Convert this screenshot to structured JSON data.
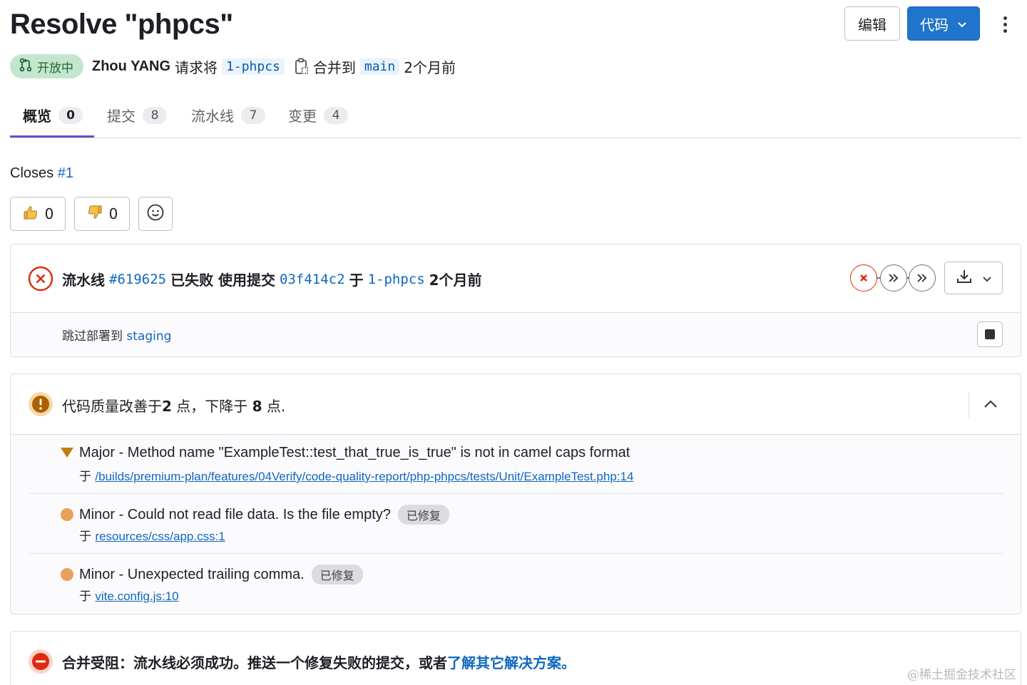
{
  "header": {
    "title": "Resolve \"phpcs\"",
    "edit_label": "编辑",
    "code_label": "代码"
  },
  "meta": {
    "status": "开放中",
    "author": "Zhou YANG",
    "request_text": "请求将",
    "source_branch": "1-phpcs",
    "merge_to_text": "合并到",
    "target_branch": "main",
    "time_ago": "2个月前"
  },
  "tabs": [
    {
      "label": "概览",
      "count": "0"
    },
    {
      "label": "提交",
      "count": "8"
    },
    {
      "label": "流水线",
      "count": "7"
    },
    {
      "label": "变更",
      "count": "4"
    }
  ],
  "description": {
    "closes_prefix": "Closes ",
    "closes_issue": "#1"
  },
  "awards": {
    "thumbs_up": "0",
    "thumbs_down": "0"
  },
  "pipeline": {
    "prefix": "流水线",
    "id": "#619625",
    "status_text": "已失败 使用提交",
    "commit": "03f414c2",
    "on_text": "于",
    "branch": "1-phpcs",
    "time_ago": "2个月前",
    "deploy_prefix": "跳过部署到",
    "environment": "staging"
  },
  "code_quality": {
    "summary_pre": "代码质量改善于",
    "improved": "2",
    "summary_mid": " 点，下降于 ",
    "degraded": "8",
    "summary_post": " 点.",
    "issues": [
      {
        "severity": "Major",
        "text": "Major - Method name \"ExampleTest::test_that_true_is_true\" is not in camel caps format",
        "in_text": "于",
        "path": "/builds/premium-plan/features/04Verify/code-quality-report/php-phpcs/tests/Unit/ExampleTest.php:14",
        "fixed": ""
      },
      {
        "severity": "Minor",
        "text": "Minor - Could not read file data. Is the file empty?",
        "in_text": "于",
        "path": "resources/css/app.css:1",
        "fixed": "已修复"
      },
      {
        "severity": "Minor",
        "text": "Minor - Unexpected trailing comma.",
        "in_text": "于",
        "path": "vite.config.js:10",
        "fixed": "已修复"
      }
    ]
  },
  "merge_blocked": {
    "text": "合并受阻：流水线必须成功。推送一个修复失败的提交，或者",
    "link": "了解其它解决方案。"
  },
  "watermark": "@稀土掘金技术社区",
  "colors": {
    "accent": "#1f75cb",
    "link": "#1068bf",
    "tab_active": "#6e49cb",
    "failed": "#dd2b0e",
    "major": "#c17d10",
    "minor": "#e9a05a",
    "open_badge_bg": "#c3e6cd"
  }
}
